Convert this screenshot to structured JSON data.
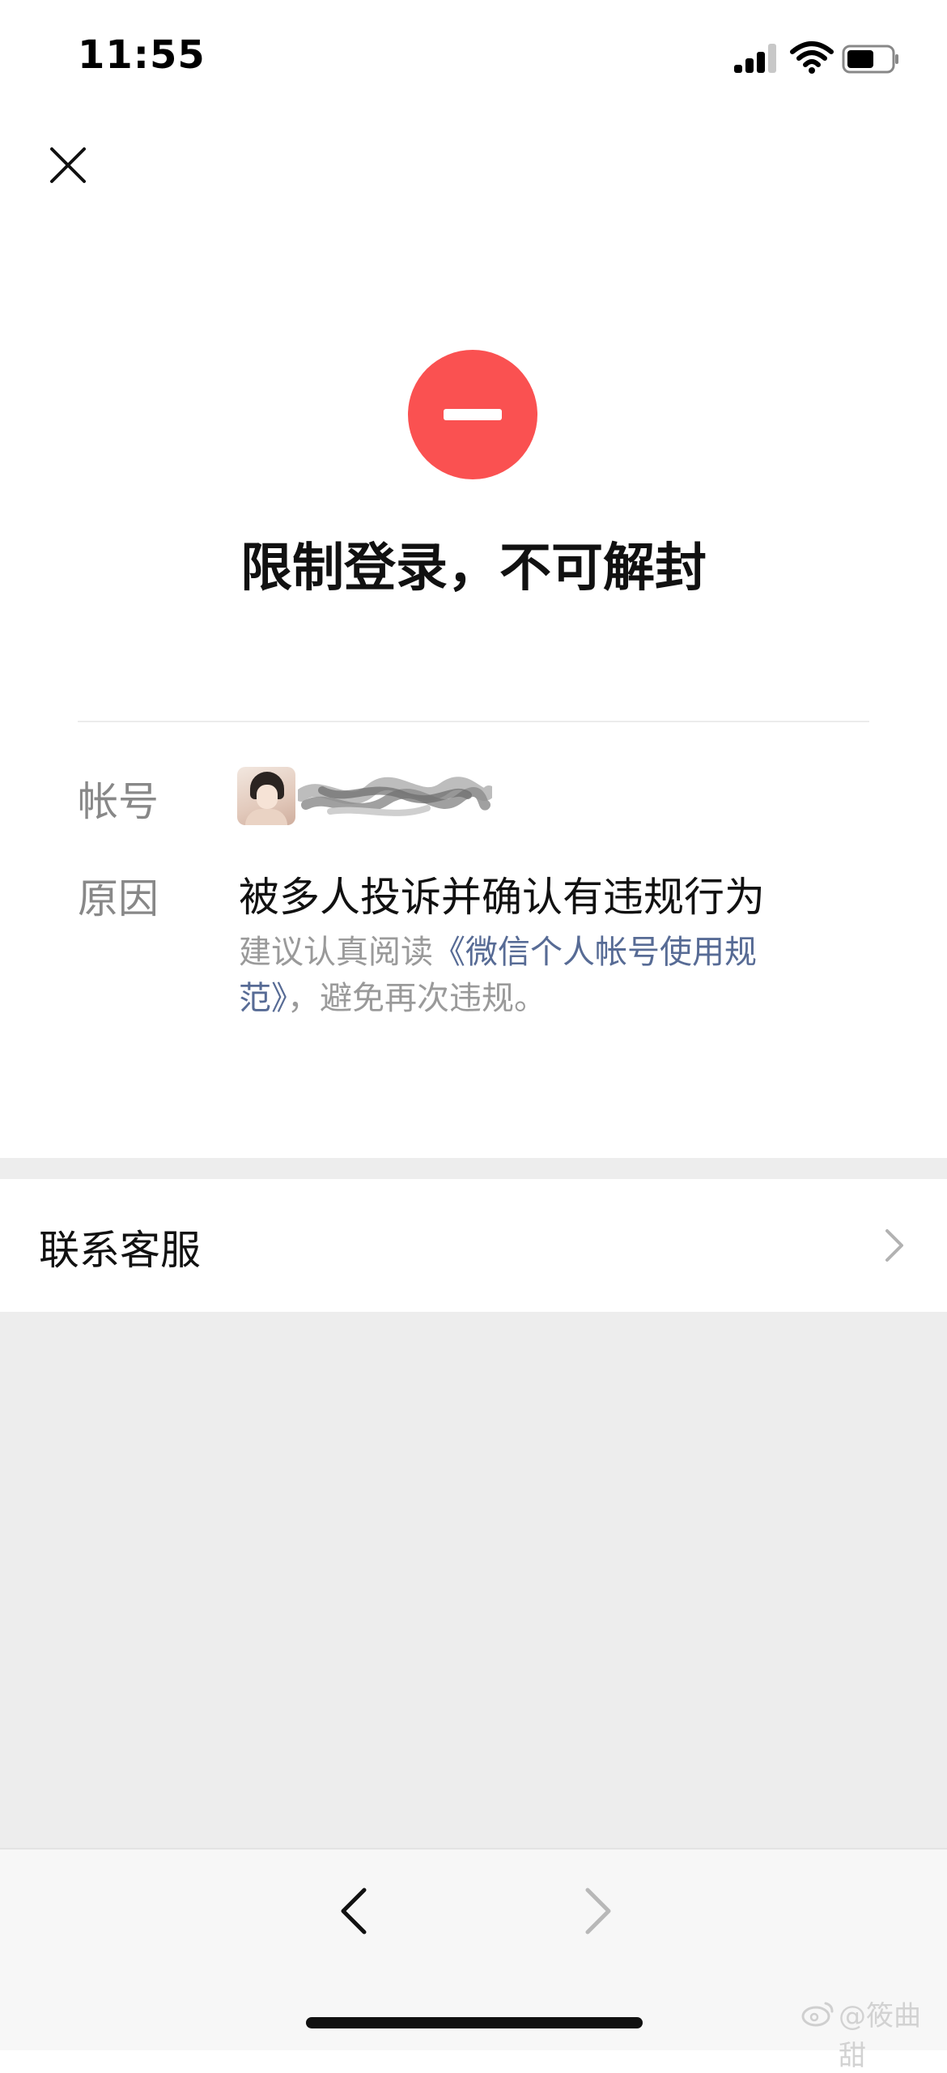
{
  "status_bar": {
    "time": "11:55"
  },
  "header": {
    "close_icon": "close-icon"
  },
  "result": {
    "status_icon": "minus-circle-icon",
    "status_color": "#fa5151",
    "title": "限制登录，不可解封"
  },
  "details": {
    "account_label": "帐号",
    "reason_label": "原因",
    "reason_text": "被多人投诉并确认有违规行为",
    "advice_prefix": "建议认真阅读",
    "advice_link": "《微信个人帐号使用规范》",
    "advice_suffix": "，避免再次违规。",
    "link_color": "#576b95"
  },
  "actions": {
    "contact_label": "联系客服"
  },
  "watermark": {
    "text": "@筱曲甜"
  }
}
